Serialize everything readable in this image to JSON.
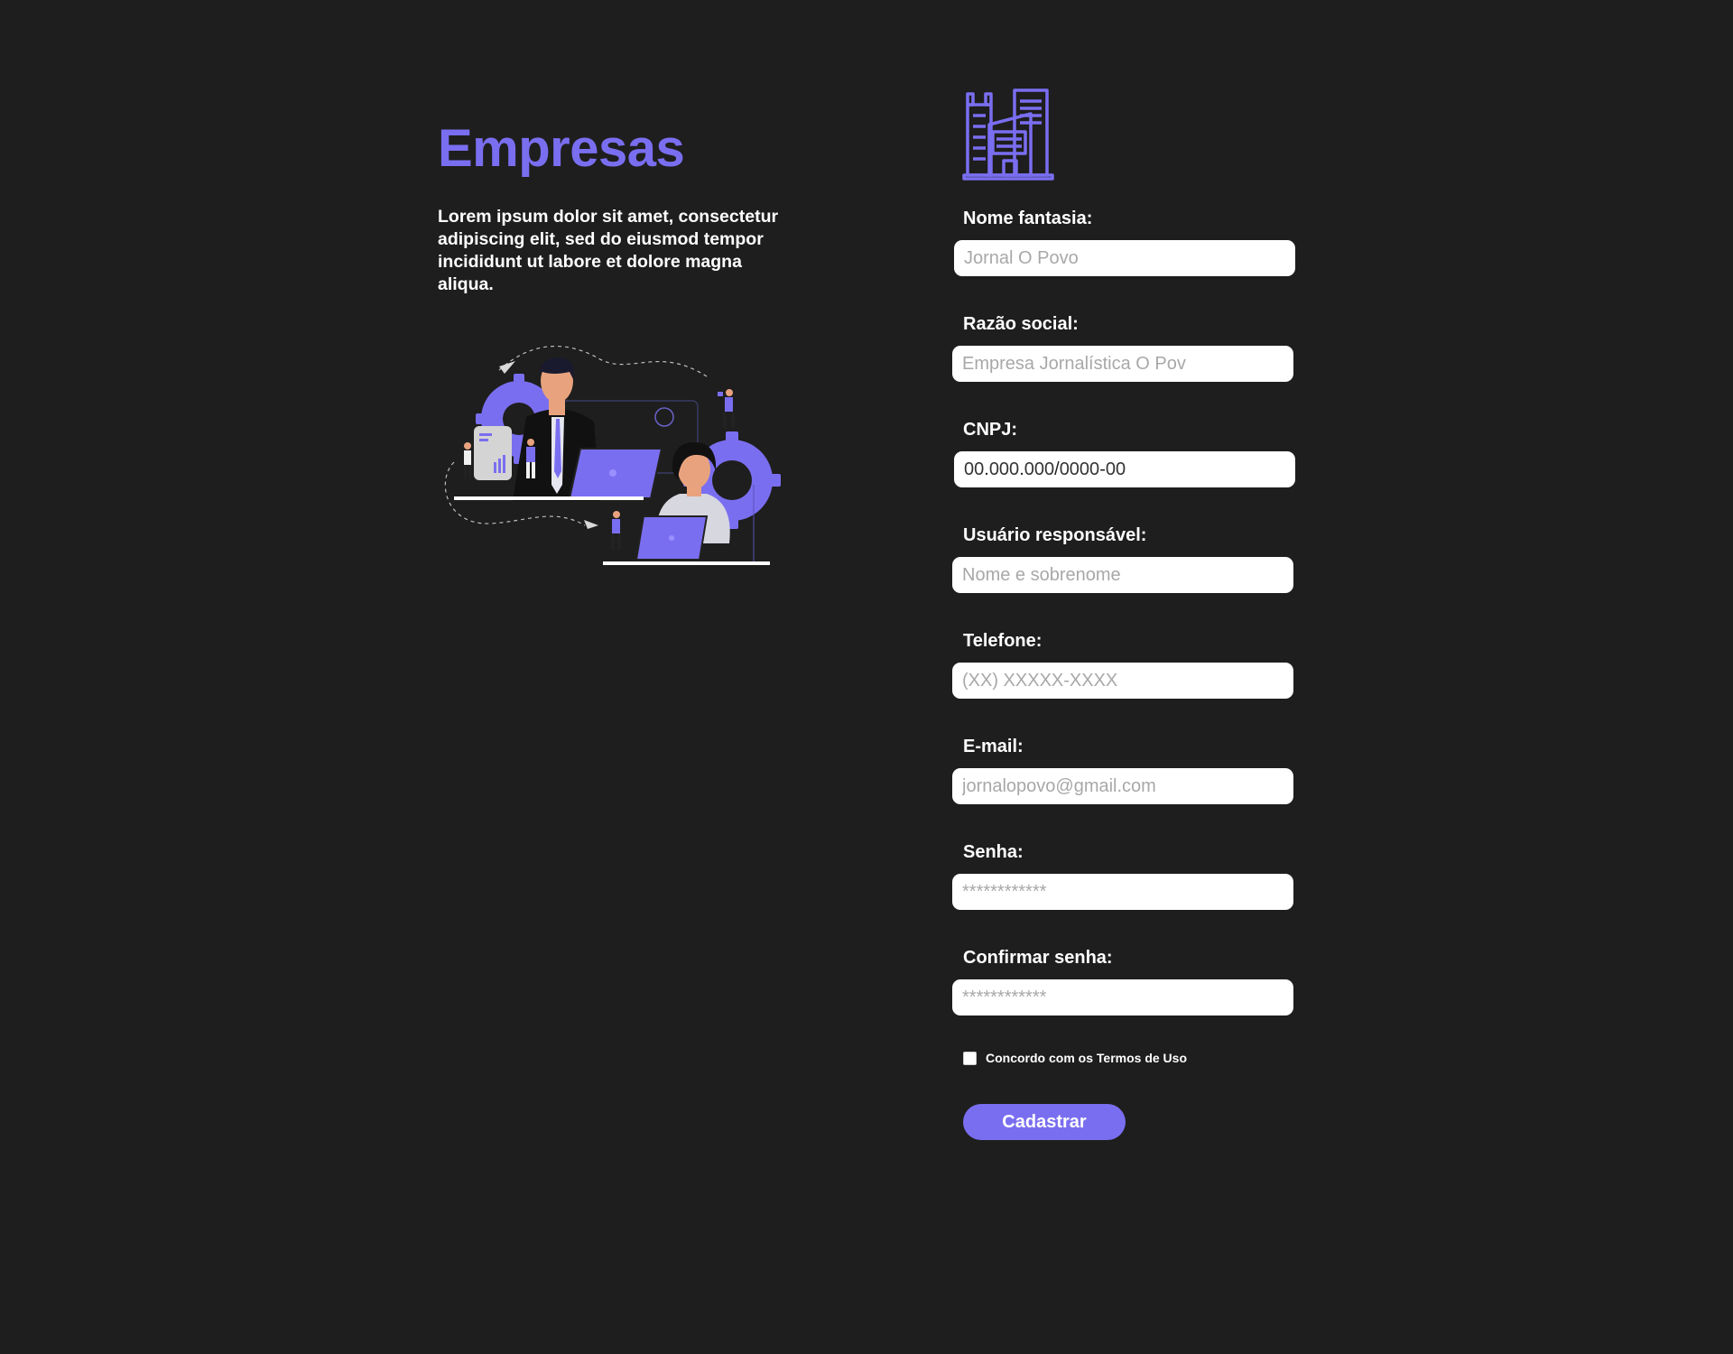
{
  "colors": {
    "background": "#1e1e1e",
    "accent": "#7a6ef0",
    "text": "#ffffff",
    "input_bg": "#ffffff",
    "placeholder": "#a8a8a8"
  },
  "intro": {
    "title": "Empresas",
    "description": "Lorem ipsum dolor sit amet, consectetur adipiscing elit, sed do eiusmod tempor incididunt ut labore et dolore magna aliqua."
  },
  "form": {
    "icon": "building-icon",
    "fields": [
      {
        "label": "Nome fantasia:",
        "placeholder": "Jornal O Povo",
        "value": ""
      },
      {
        "label": "Razão social:",
        "placeholder": "Empresa Jornalística O Pov",
        "value": ""
      },
      {
        "label": "CNPJ:",
        "placeholder": "00.000.000/0000-00",
        "value": ""
      },
      {
        "label": "Usuário responsável:",
        "placeholder": "Nome e sobrenome",
        "value": ""
      },
      {
        "label": "Telefone:",
        "placeholder": "(XX) XXXXX-XXXX",
        "value": ""
      },
      {
        "label": "E-mail:",
        "placeholder": "jornalopovo@gmail.com",
        "value": ""
      },
      {
        "label": "Senha:",
        "placeholder": "************",
        "value": ""
      },
      {
        "label": "Confirmar senha:",
        "placeholder": "************",
        "value": ""
      }
    ],
    "cnpj_mask": {
      "parts": [
        "00",
        ".",
        "000",
        ".",
        "000",
        "/",
        "0000",
        "-",
        "00"
      ]
    },
    "terms": {
      "label": "Concordo com os Termos de Uso",
      "checked": false
    },
    "submit_label": "Cadastrar"
  }
}
